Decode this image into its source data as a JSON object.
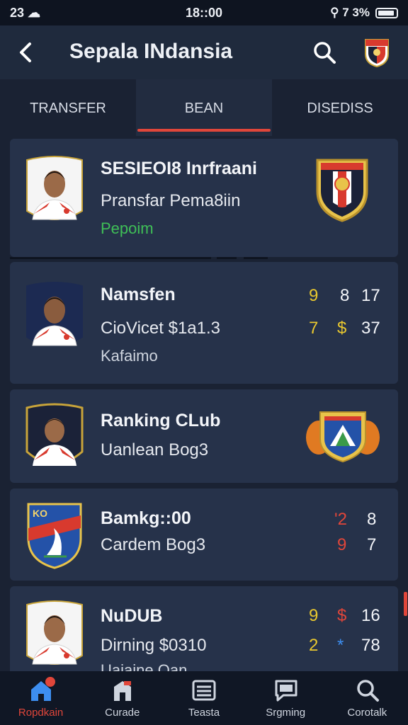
{
  "status_bar": {
    "left": "23 ☁",
    "time": "18::00",
    "right": "⚲ 7 3%"
  },
  "header": {
    "title": "Sepala INdansia"
  },
  "tabs": [
    {
      "label": "TRANSFER"
    },
    {
      "label": "BEAN"
    },
    {
      "label": "DISEDISS"
    }
  ],
  "cards": [
    {
      "line1": "SESIEOI8 Inrfraani",
      "line2": "Pransfar Pema8iin",
      "line3": "Pepoim"
    },
    {
      "line1": "Namsfen",
      "line2": "CioVicet $1a1.3",
      "line3": "Kafaimo",
      "stats": [
        [
          "9",
          "8",
          "17"
        ],
        [
          "7",
          "$",
          "37"
        ]
      ]
    },
    {
      "line1": "Ranking CLub",
      "line2": "Uanlean Bog3"
    },
    {
      "line1": "Bamkg::00",
      "line2": "Cardem Bog3",
      "stats": [
        [
          "'2",
          "8"
        ],
        [
          "9",
          "7"
        ]
      ]
    },
    {
      "line1": "NuDUB",
      "line2": "Dirning $0310",
      "line3": "Uaiaine Oan",
      "stats": [
        [
          "9",
          "$",
          "16"
        ],
        [
          "2",
          "*",
          "78"
        ]
      ]
    }
  ],
  "bottom_nav": [
    {
      "label": "Ropdkain",
      "icon": "home-icon"
    },
    {
      "label": "Curade",
      "icon": "stadium-icon"
    },
    {
      "label": "Teasta",
      "icon": "list-icon"
    },
    {
      "label": "Srgming",
      "icon": "chat-icon"
    },
    {
      "label": "Corotalk",
      "icon": "search-icon"
    }
  ],
  "colors": {
    "background": "#1a2233",
    "card": "#26324a",
    "accent": "#e0463a",
    "green": "#3fbf57",
    "yellow": "#e9c82f"
  }
}
